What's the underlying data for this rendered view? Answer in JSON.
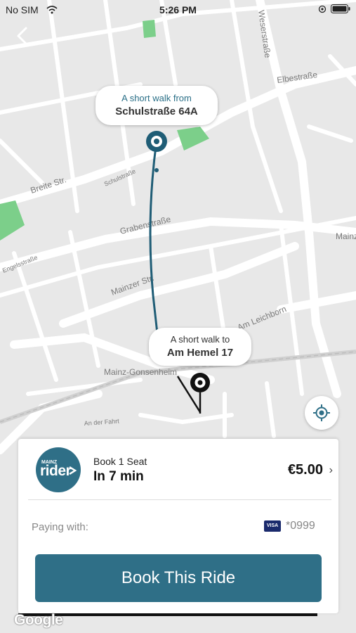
{
  "status_bar": {
    "carrier": "No SIM",
    "time": "5:26 PM"
  },
  "map": {
    "streets": [
      "Breite Str.",
      "Grabenstraße",
      "Mainzer Str.",
      "Elbestraße",
      "Weserstraße",
      "Schulstraße",
      "Am Leichborn",
      "An der Fahrt",
      "Engelsstraße",
      "Mainz-Gonsenheim"
    ],
    "colors": {
      "route": "#1f5d76",
      "park": "#7ccf8a"
    }
  },
  "pickup_bubble": {
    "line1": "A short walk from",
    "line2": "Schulstraße 64A"
  },
  "dropoff_bubble": {
    "line1": "A short walk to",
    "line2": "Am Hemel 17"
  },
  "ride": {
    "logo_small": "MAINZ",
    "logo_big": "rider",
    "seat": "Book 1 Seat",
    "eta": "In 7 min",
    "price": "€5.00"
  },
  "payment": {
    "label": "Paying with:",
    "card_brand": "VISA",
    "card": "*0999"
  },
  "book_button": "Book This Ride",
  "attribution": "Google",
  "icons": [
    "back-arrow-icon",
    "wifi-icon",
    "battery-icon",
    "locate-icon",
    "chevron-right-icon",
    "visa-icon"
  ],
  "accent": "#2f6f87"
}
